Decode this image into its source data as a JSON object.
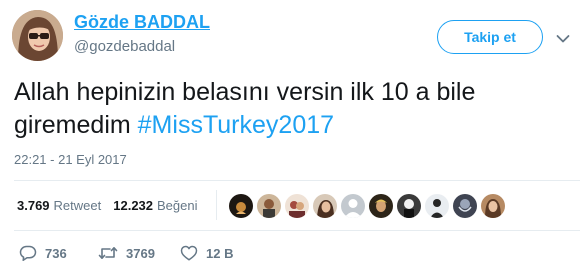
{
  "user": {
    "display_name": "Gözde BADDAL",
    "handle": "@gozdebaddal"
  },
  "follow_button": {
    "label": "Takip et"
  },
  "tweet": {
    "text_before": "Allah hepinizin belasını versin ilk 10 a bile giremedim ",
    "hashtag": "#MissTurkey2017",
    "timestamp": "22:21 - 21 Eyl 2017"
  },
  "stats": {
    "retweets_count": "3.769",
    "retweets_label": "Retweet",
    "likes_count": "12.232",
    "likes_label": "Beğeni"
  },
  "likers_avatar_count": 10,
  "actions": {
    "replies": "736",
    "retweets": "3769",
    "likes": "12 B"
  },
  "colors": {
    "accent": "#1da1f2",
    "secondary_text": "#657786",
    "primary_text": "#14171a",
    "divider": "#e6ecf0"
  },
  "icons": {
    "reply": "reply-icon",
    "retweet": "retweet-icon",
    "like": "heart-icon",
    "more": "chevron-down-icon"
  }
}
